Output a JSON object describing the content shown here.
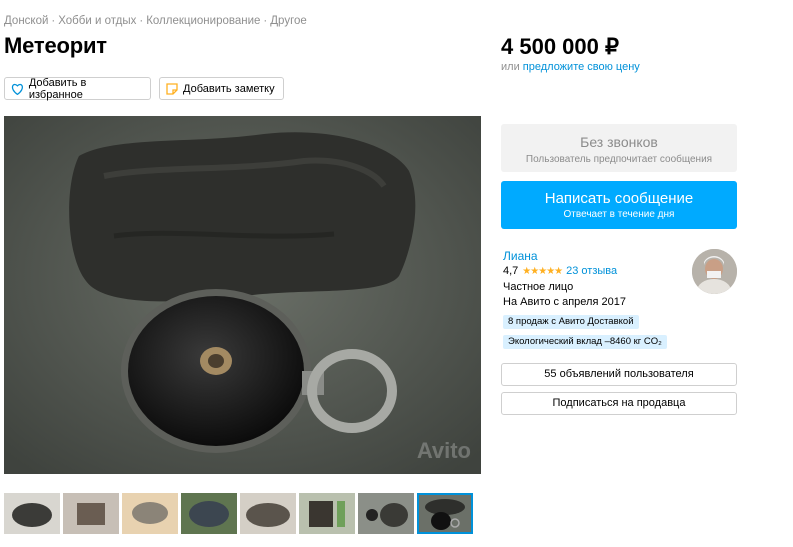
{
  "breadcrumb": [
    "Донской",
    "Хобби и отдых",
    "Коллекционирование",
    "Другое"
  ],
  "title": "Метеорит",
  "price": "4 500 000 ₽",
  "offer": {
    "prefix": "или",
    "link": "предложите свою цену"
  },
  "actions": {
    "favorite": "Добавить в избранное",
    "note": "Добавить заметку"
  },
  "photo": {
    "watermark": "Avito"
  },
  "thumbnails_count": 8,
  "contact": {
    "no_calls_title": "Без звонков",
    "no_calls_sub": "Пользователь предпочитает сообщения",
    "write_title": "Написать сообщение",
    "write_sub": "Отвечает в течение дня"
  },
  "seller": {
    "name": "Лиана",
    "rating": "4,7",
    "stars": "★★★★★",
    "reviews": "23 отзыва",
    "type": "Частное лицо",
    "since": "На Авито с апреля 2017",
    "badge_sales": "8 продаж с Авито Доставкой",
    "badge_eco": "Экологический вклад –8460 кг CO₂"
  },
  "buttons": {
    "listings": "55 объявлений пользователя",
    "subscribe": "Подписаться на продавца"
  },
  "colors": {
    "accent": "#00aaff",
    "link": "#0091d9",
    "star": "#ffb021"
  }
}
